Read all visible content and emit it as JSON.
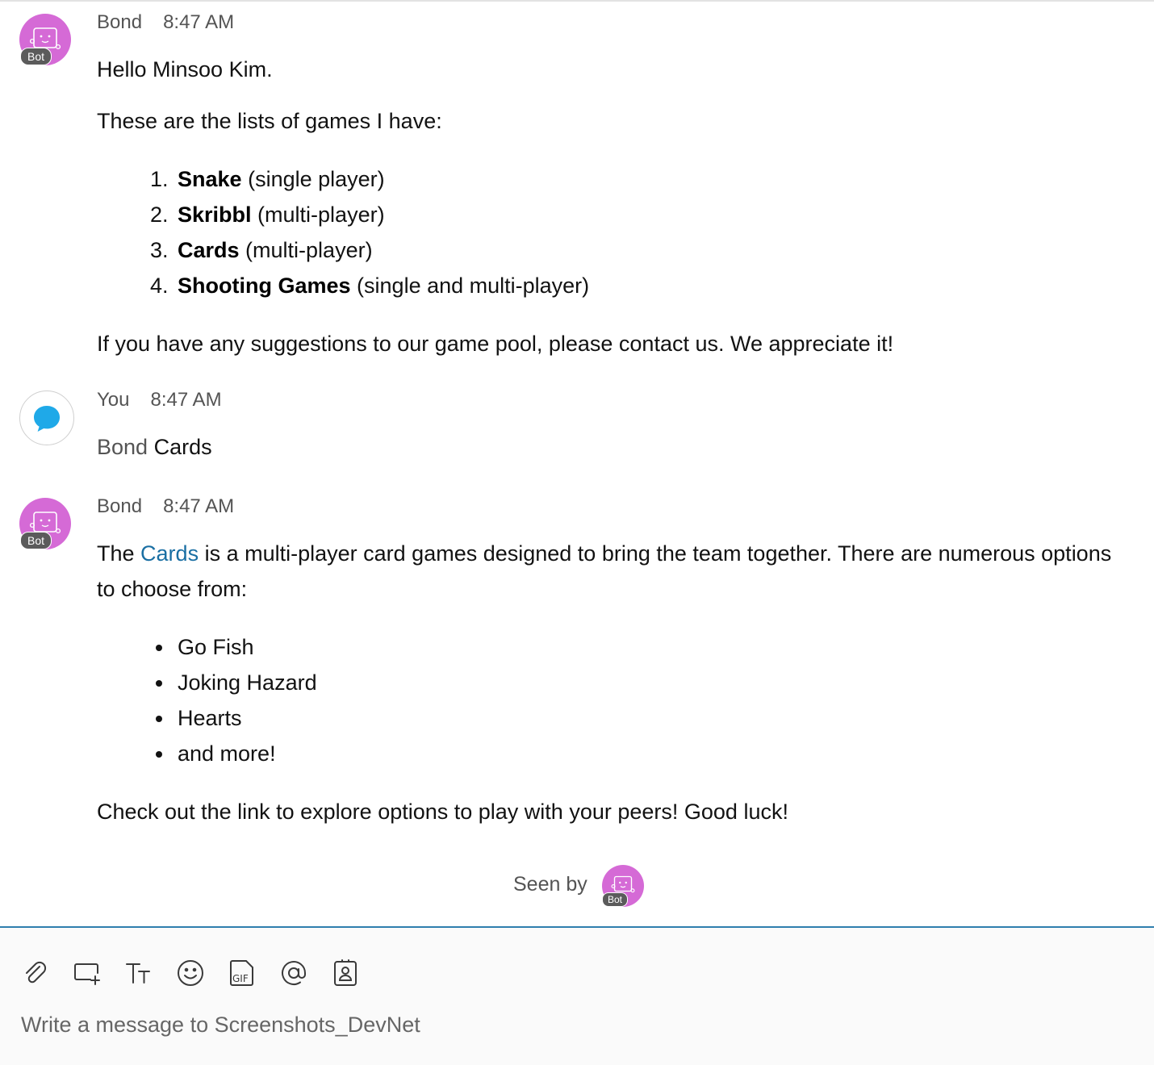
{
  "messages": [
    {
      "sender": "Bond",
      "time": "8:47 AM",
      "badge": "Bot",
      "greeting": "Hello Minsoo Kim.",
      "intro": "These are the lists of games I have:",
      "games": [
        {
          "number": "1.",
          "name": "Snake",
          "mode": "(single player)"
        },
        {
          "number": "2.",
          "name": "Skribbl",
          "mode": "(multi-player)"
        },
        {
          "number": "3.",
          "name": "Cards",
          "mode": "(multi-player)"
        },
        {
          "number": "4.",
          "name": "Shooting Games",
          "mode": "(single and multi-player)"
        }
      ],
      "outro": "If you have any suggestions to our game pool, please contact us. We appreciate it!"
    },
    {
      "sender": "You",
      "time": "8:47 AM",
      "mention": "Bond",
      "text": "Cards"
    },
    {
      "sender": "Bond",
      "time": "8:47 AM",
      "badge": "Bot",
      "text_before_link": "The",
      "link": "Cards",
      "text_after_link": "is a multi-player card games designed to bring the team together. There are numerous options to choose from:",
      "options": [
        "Go Fish",
        "Joking Hazard",
        "Hearts",
        "and more!"
      ],
      "outro": "Check out the link to explore options to play with your peers! Good luck!"
    }
  ],
  "seen_by": {
    "label": "Seen by",
    "badge": "Bot"
  },
  "composer": {
    "placeholder": "Write a message to Screenshots_DevNet",
    "tools": [
      {
        "name": "attach-icon"
      },
      {
        "name": "share-screen-icon"
      },
      {
        "name": "text-format-icon"
      },
      {
        "name": "emoji-icon"
      },
      {
        "name": "gif-icon"
      },
      {
        "name": "mention-icon"
      },
      {
        "name": "contact-card-icon"
      }
    ]
  },
  "colors": {
    "bot_avatar": "#d56ad6",
    "link": "#1a6fa3",
    "composer_border": "#2f7fae",
    "user_bubble": "#1fa9e8"
  }
}
